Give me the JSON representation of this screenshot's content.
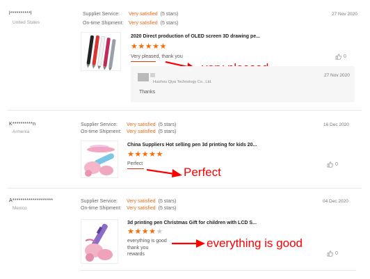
{
  "labels": {
    "supplier_service": "Supplier Service:",
    "ontime_shipment": "On-time Shipment:"
  },
  "colors": {
    "accent": "#e86b1a",
    "annotation": "#ff0000",
    "star": "#ff6a00"
  },
  "reviews": [
    {
      "buyer": "l**********l",
      "country": "United States",
      "supplier_service": "Very satisfied",
      "supplier_stars": "(5 stars)",
      "ontime_shipment": "Very satisfied",
      "ontime_stars": "(5 stars)",
      "date": "27 Nov 2020",
      "product_title": "2020 Direct production of OLED screen 3D drawing pe...",
      "rating": 5,
      "stars_text": "★★★★★",
      "text": "Very pleased, thank you",
      "likes": "0",
      "annotation": "very pleased",
      "reply": {
        "seller": "Huizhou Qiya Technology Co., Ltd.",
        "date": "27 Nov 2020",
        "text": "Thanks"
      }
    },
    {
      "buyer": "K**********n",
      "country": "Armenia",
      "supplier_service": "Very satisfied",
      "supplier_stars": "(5 stars)",
      "ontime_shipment": "Very satisfied",
      "ontime_stars": "(5 stars)",
      "date": "16 Dec 2020",
      "product_title": "China Suppliers Hot selling pen 3d printing for kids 20...",
      "rating": 5,
      "stars_text": "★★★★★",
      "text": "Perfect",
      "likes": "0",
      "annotation": "Perfect"
    },
    {
      "buyer": "A********************",
      "country": "Mexico",
      "supplier_service": "Very satisfied",
      "supplier_stars": "(5 stars)",
      "ontime_shipment": "Very satisfied",
      "ontime_stars": "(5 stars)",
      "date": "04 Dec 2020",
      "product_title": "3d printing pen Christmas Gift for children with LCD S...",
      "rating": 4,
      "stars_on": "★★★★",
      "stars_off": "★",
      "text_lines": [
        "everything is good",
        "thank you",
        "rewards"
      ],
      "likes": "0",
      "annotation": "everything is good"
    }
  ]
}
